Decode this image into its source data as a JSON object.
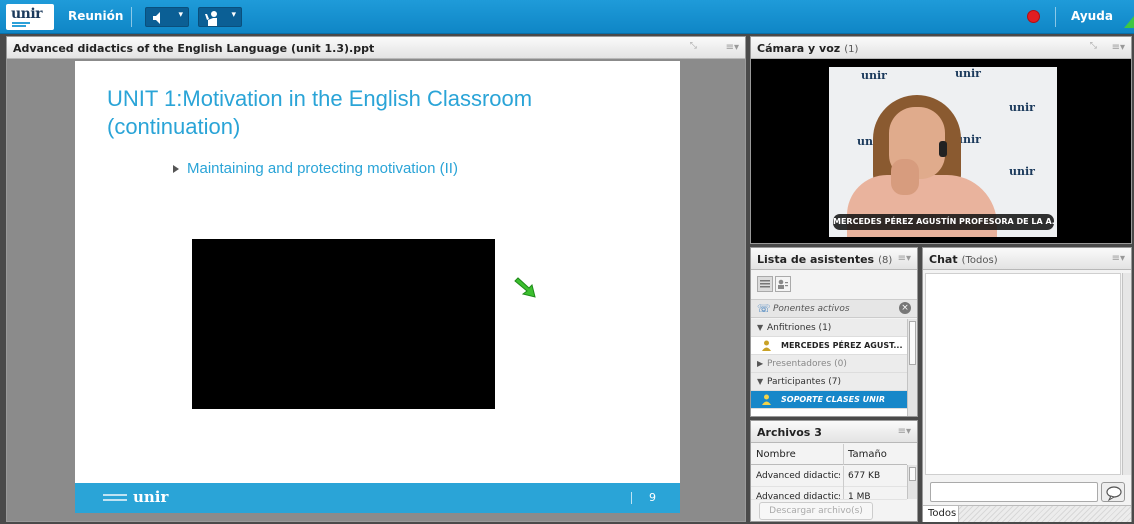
{
  "topbar": {
    "logo": "unir",
    "meeting_label": "Reunión",
    "help_label": "Ayuda",
    "record_icon": "record-icon",
    "colors": {
      "bar": "#1f9bd9",
      "record": "#e21d22"
    }
  },
  "presentation": {
    "title": "Advanced didactics of the English Language (unit 1.3).ppt",
    "slide": {
      "title": "UNIT 1:Motivation in the English Classroom (continuation)",
      "bullet": "Maintaining and protecting motivation (II)",
      "footer_logo": "unir",
      "page_number": "9",
      "accent_color": "#2aa4d7"
    }
  },
  "camera": {
    "title": "Cámara y voz",
    "count": "(1)",
    "name_caption": "MERCEDES PÉREZ AGUSTÍN PROFESORA DE LA A..."
  },
  "attendees": {
    "title": "Lista de asistentes",
    "count": "(8)",
    "active_speakers": "Ponentes activos",
    "groups": {
      "hosts": "Anfitriones (1)",
      "host_name": "MERCEDES PÉREZ AGUST...",
      "presenters": "Presentadores (0)",
      "participants": "Participantes (7)",
      "selected_participant": "SOPORTE CLASES UNIR"
    }
  },
  "files": {
    "title": "Archivos",
    "count": "3",
    "columns": [
      "Nombre",
      "Tamaño"
    ],
    "rows": [
      {
        "name": "Advanced didactics",
        "size": "677 KB"
      },
      {
        "name": "Advanced didactics",
        "size": "1 MB"
      }
    ],
    "download_label": "Descargar archivo(s)"
  },
  "chat": {
    "title": "Chat",
    "scope": "(Todos)",
    "input_value": "",
    "tab_label": "Todos"
  }
}
